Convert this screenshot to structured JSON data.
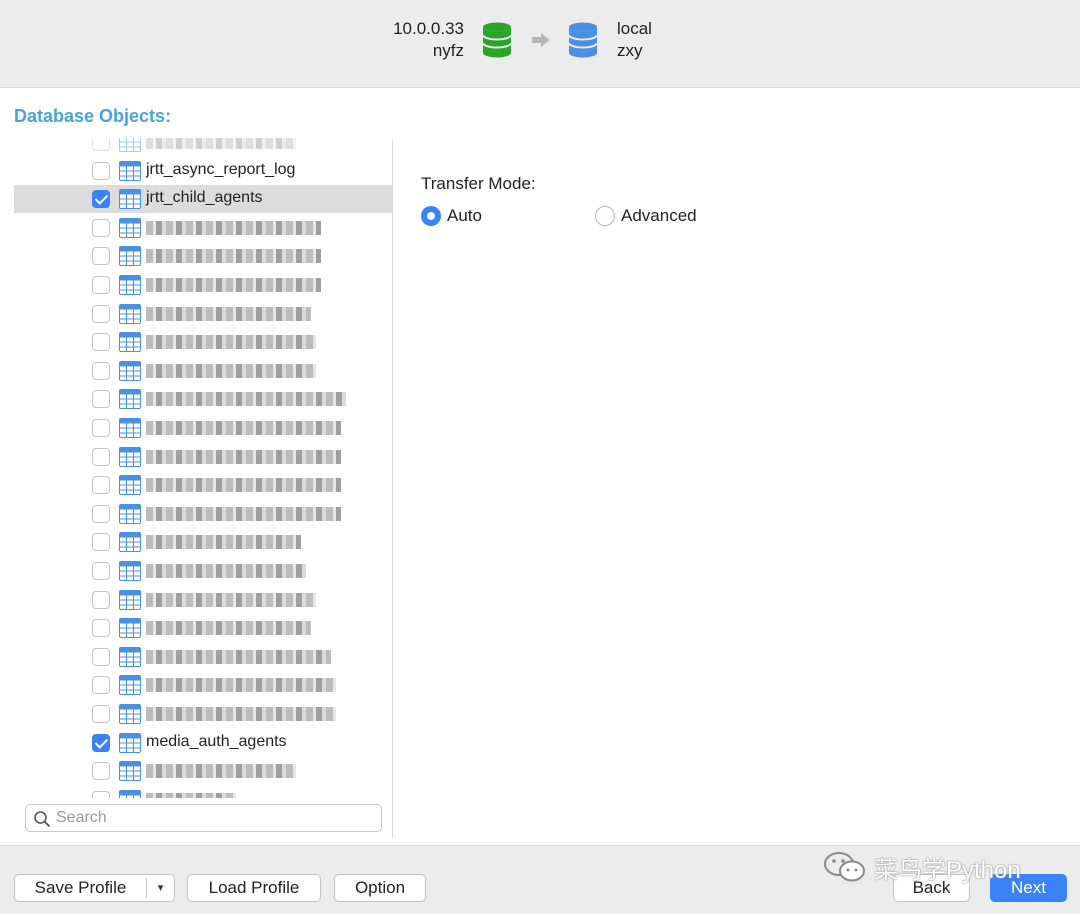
{
  "header": {
    "source": {
      "host": "10.0.0.33",
      "database": "nyfz",
      "icon": "database-green-icon",
      "color": "#2aa52a"
    },
    "target": {
      "host": "local",
      "database": "zxy",
      "icon": "database-blue-icon",
      "color": "#4a90e2"
    },
    "arrow_icon": "arrow-right-icon"
  },
  "section_title": "Database Objects:",
  "tree": {
    "rows": [
      {
        "label": "",
        "checked": false,
        "blurred": true,
        "faded": true
      },
      {
        "label": "jrtt_async_report_log",
        "checked": false,
        "blurred": false
      },
      {
        "label": "jrtt_child_agents",
        "checked": true,
        "blurred": false,
        "selected": true
      },
      {
        "label": "",
        "checked": false,
        "blurred": true
      },
      {
        "label": "",
        "checked": false,
        "blurred": true
      },
      {
        "label": "",
        "checked": false,
        "blurred": true
      },
      {
        "label": "",
        "checked": false,
        "blurred": true
      },
      {
        "label": "",
        "checked": false,
        "blurred": true
      },
      {
        "label": "",
        "checked": false,
        "blurred": true
      },
      {
        "label": "",
        "checked": false,
        "blurred": true
      },
      {
        "label": "",
        "checked": false,
        "blurred": true
      },
      {
        "label": "",
        "checked": false,
        "blurred": true
      },
      {
        "label": "",
        "checked": false,
        "blurred": true
      },
      {
        "label": "",
        "checked": false,
        "blurred": true
      },
      {
        "label": "",
        "checked": false,
        "blurred": true
      },
      {
        "label": "",
        "checked": false,
        "blurred": true
      },
      {
        "label": "",
        "checked": false,
        "blurred": true
      },
      {
        "label": "",
        "checked": false,
        "blurred": true
      },
      {
        "label": "",
        "checked": false,
        "blurred": true
      },
      {
        "label": "",
        "checked": false,
        "blurred": true
      },
      {
        "label": "",
        "checked": false,
        "blurred": true
      },
      {
        "label": "media_auth_agents",
        "checked": true,
        "blurred": false
      },
      {
        "label": "",
        "checked": false,
        "blurred": true
      },
      {
        "label": "",
        "checked": false,
        "blurred": true
      }
    ]
  },
  "search": {
    "placeholder": "Search",
    "value": ""
  },
  "transfer": {
    "label": "Transfer Mode:",
    "options": [
      {
        "label": "Auto",
        "selected": true
      },
      {
        "label": "Advanced",
        "selected": false
      }
    ]
  },
  "footer": {
    "save_profile": "Save Profile",
    "save_profile_caret": "▾",
    "load_profile": "Load Profile",
    "option": "Option",
    "back": "Back",
    "next": "Next",
    "watermark": "菜鸟学Python"
  }
}
